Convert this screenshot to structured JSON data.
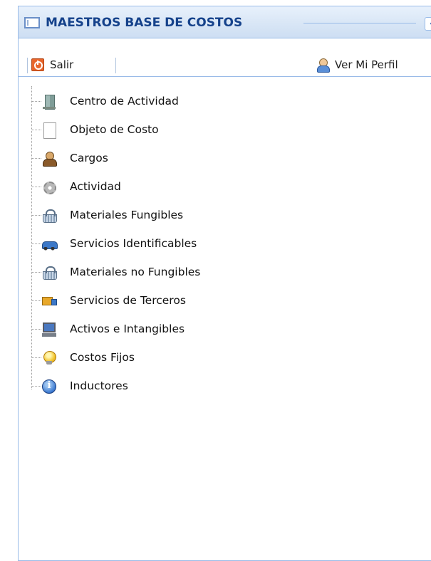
{
  "panel": {
    "title": "MAESTROS BASE DE COSTOS",
    "collapse_label": "«"
  },
  "toolbar": {
    "salir_label": "Salir",
    "perfil_label": "Ver Mi Perfil"
  },
  "tree": {
    "items": [
      {
        "label": "Centro de Actividad",
        "icon": "building-icon"
      },
      {
        "label": "Objeto de Costo",
        "icon": "document-icon"
      },
      {
        "label": "Cargos",
        "icon": "person-icon"
      },
      {
        "label": "Actividad",
        "icon": "gear-icon"
      },
      {
        "label": "Materiales Fungibles",
        "icon": "basket-icon"
      },
      {
        "label": "Servicios Identificables",
        "icon": "car-icon"
      },
      {
        "label": "Materiales no Fungibles",
        "icon": "basket-icon"
      },
      {
        "label": "Servicios de Terceros",
        "icon": "truck-icon"
      },
      {
        "label": "Activos e Intangibles",
        "icon": "computer-icon"
      },
      {
        "label": "Costos Fijos",
        "icon": "lightbulb-icon"
      },
      {
        "label": "Inductores",
        "icon": "info-icon"
      }
    ]
  },
  "colors": {
    "header_text": "#15428b",
    "panel_border": "#99bbe8"
  }
}
